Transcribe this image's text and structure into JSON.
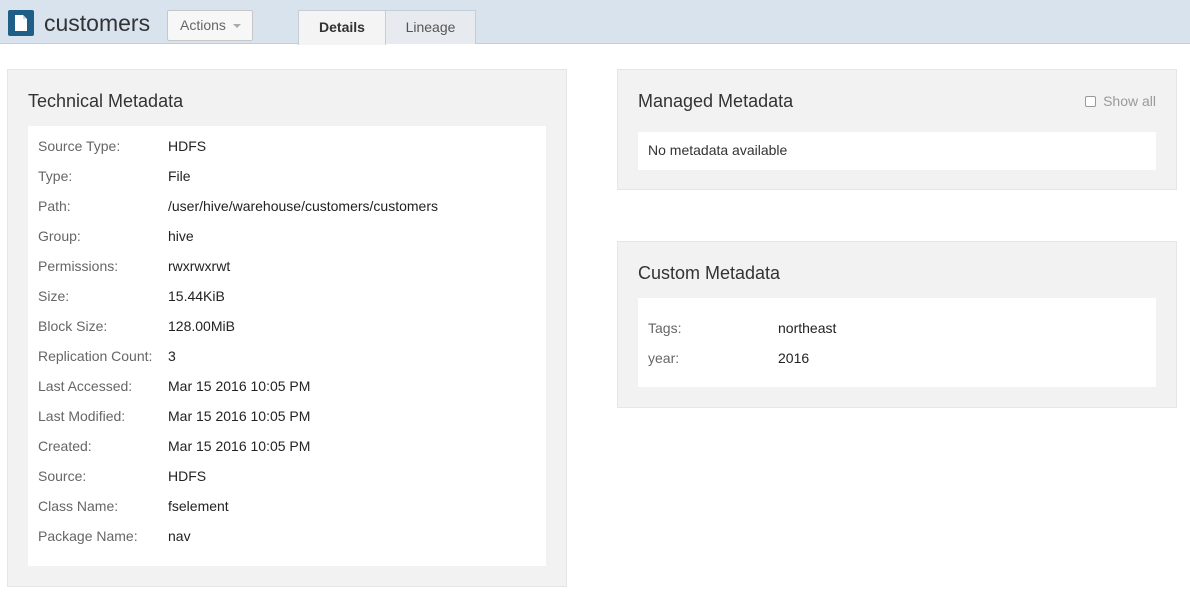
{
  "header": {
    "title": "customers",
    "actions_label": "Actions",
    "tabs": [
      {
        "label": "Details",
        "active": true
      },
      {
        "label": "Lineage",
        "active": false
      }
    ]
  },
  "technical_metadata": {
    "title": "Technical Metadata",
    "rows": [
      {
        "label": "Source Type:",
        "value": "HDFS"
      },
      {
        "label": "Type:",
        "value": "File"
      },
      {
        "label": "Path:",
        "value": "/user/hive/warehouse/customers/customers"
      },
      {
        "label": "Group:",
        "value": "hive"
      },
      {
        "label": "Permissions:",
        "value": "rwxrwxrwt"
      },
      {
        "label": "Size:",
        "value": "15.44KiB"
      },
      {
        "label": "Block Size:",
        "value": "128.00MiB"
      },
      {
        "label": "Replication Count:",
        "value": "3"
      },
      {
        "label": "Last Accessed:",
        "value": "Mar 15 2016 10:05 PM"
      },
      {
        "label": "Last Modified:",
        "value": "Mar 15 2016 10:05 PM"
      },
      {
        "label": "Created:",
        "value": "Mar 15 2016 10:05 PM"
      },
      {
        "label": "Source:",
        "value": "HDFS"
      },
      {
        "label": "Class Name:",
        "value": "fselement"
      },
      {
        "label": "Package Name:",
        "value": "nav"
      }
    ]
  },
  "managed_metadata": {
    "title": "Managed Metadata",
    "show_all_label": "Show all",
    "empty_text": "No metadata available"
  },
  "custom_metadata": {
    "title": "Custom Metadata",
    "rows": [
      {
        "label": "Tags:",
        "value": "northeast"
      },
      {
        "label": "year:",
        "value": "2016"
      }
    ]
  },
  "colors": {
    "header_bg": "#d9e3ee",
    "icon_bg": "#1f5f87",
    "panel_bg": "#f2f2f2"
  },
  "icons": {
    "entity": "file-icon",
    "actions": "caret-down-icon"
  }
}
